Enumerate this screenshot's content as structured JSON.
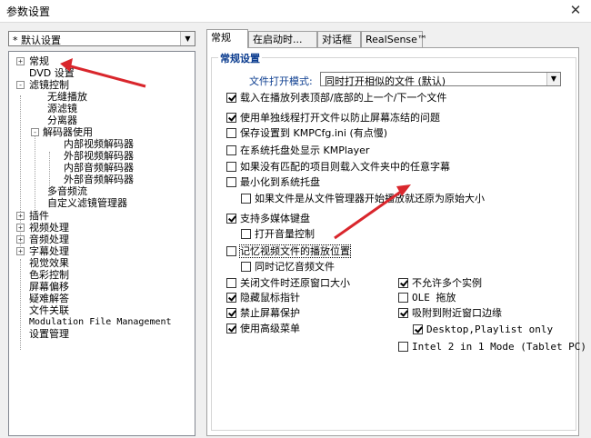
{
  "window": {
    "title": "参数设置"
  },
  "profile": {
    "selected": "* 默认设置"
  },
  "tree": [
    {
      "label": "常规",
      "box": "+"
    },
    {
      "label": "DVD 设置"
    },
    {
      "label": "滤镜控制",
      "box": "-"
    },
    {
      "label": "无缝播放"
    },
    {
      "label": "源滤镜"
    },
    {
      "label": "分离器"
    },
    {
      "label": "解码器使用",
      "box": "-"
    },
    {
      "label": "内部视频解码器"
    },
    {
      "label": "外部视频解码器"
    },
    {
      "label": "内部音频解码器"
    },
    {
      "label": "外部音频解码器"
    },
    {
      "label": "多音频流"
    },
    {
      "label": "自定义滤镜管理器"
    },
    {
      "label": "插件",
      "box": "+"
    },
    {
      "label": "视频处理",
      "box": "+"
    },
    {
      "label": "音频处理",
      "box": "+"
    },
    {
      "label": "字幕处理",
      "box": "+"
    },
    {
      "label": "视觉效果"
    },
    {
      "label": "色彩控制"
    },
    {
      "label": "屏幕偏移"
    },
    {
      "label": "疑难解答"
    },
    {
      "label": "文件关联"
    },
    {
      "label": "Modulation File Management"
    },
    {
      "label": "设置管理"
    }
  ],
  "tabs": [
    "常规",
    "在启动时...",
    "对话框",
    "RealSense™"
  ],
  "general": {
    "group_title": "常规设置",
    "file_open_label": "文件打开模式:",
    "file_open_value": "同时打开相似的文件 (默认)",
    "options": [
      {
        "label": "载入在播放列表顶部/底部的上一个/下一个文件",
        "checked": true
      },
      {
        "label": "使用单独线程打开文件以防止屏幕冻结的问题",
        "checked": true
      },
      {
        "label": "保存设置到 KMPCfg.ini (有点慢)",
        "checked": false
      },
      {
        "label": "在系统托盘处显示 KMPlayer",
        "checked": false
      },
      {
        "label": "如果没有匹配的项目则载入文件夹中的任意字幕",
        "checked": false
      },
      {
        "label": "最小化到系统托盘",
        "checked": false
      },
      {
        "label": "如果文件是从文件管理器开始播放就还原为原始大小",
        "checked": false
      },
      {
        "label": "支持多媒体键盘",
        "checked": true
      },
      {
        "label": "打开音量控制",
        "checked": false
      },
      {
        "label": "记忆视频文件的播放位置",
        "checked": false
      },
      {
        "label": "同时记忆音频文件",
        "checked": false
      },
      {
        "label": "关闭文件时还原窗口大小",
        "checked": false
      },
      {
        "label": "隐藏鼠标指针",
        "checked": true
      },
      {
        "label": "禁止屏幕保护",
        "checked": true
      },
      {
        "label": "使用高级菜单",
        "checked": true
      },
      {
        "label": "不允许多个实例",
        "checked": true
      },
      {
        "label": "OLE 拖放",
        "checked": false
      },
      {
        "label": "吸附到附近窗口边缘",
        "checked": true
      },
      {
        "label": "Desktop,Playlist only",
        "checked": true
      },
      {
        "label": "Intel 2 in 1 Mode (Tablet PC)",
        "checked": false
      }
    ]
  },
  "colors": {
    "accent_blue": "#0b3c8f",
    "annotation_red": "#d9262c"
  }
}
